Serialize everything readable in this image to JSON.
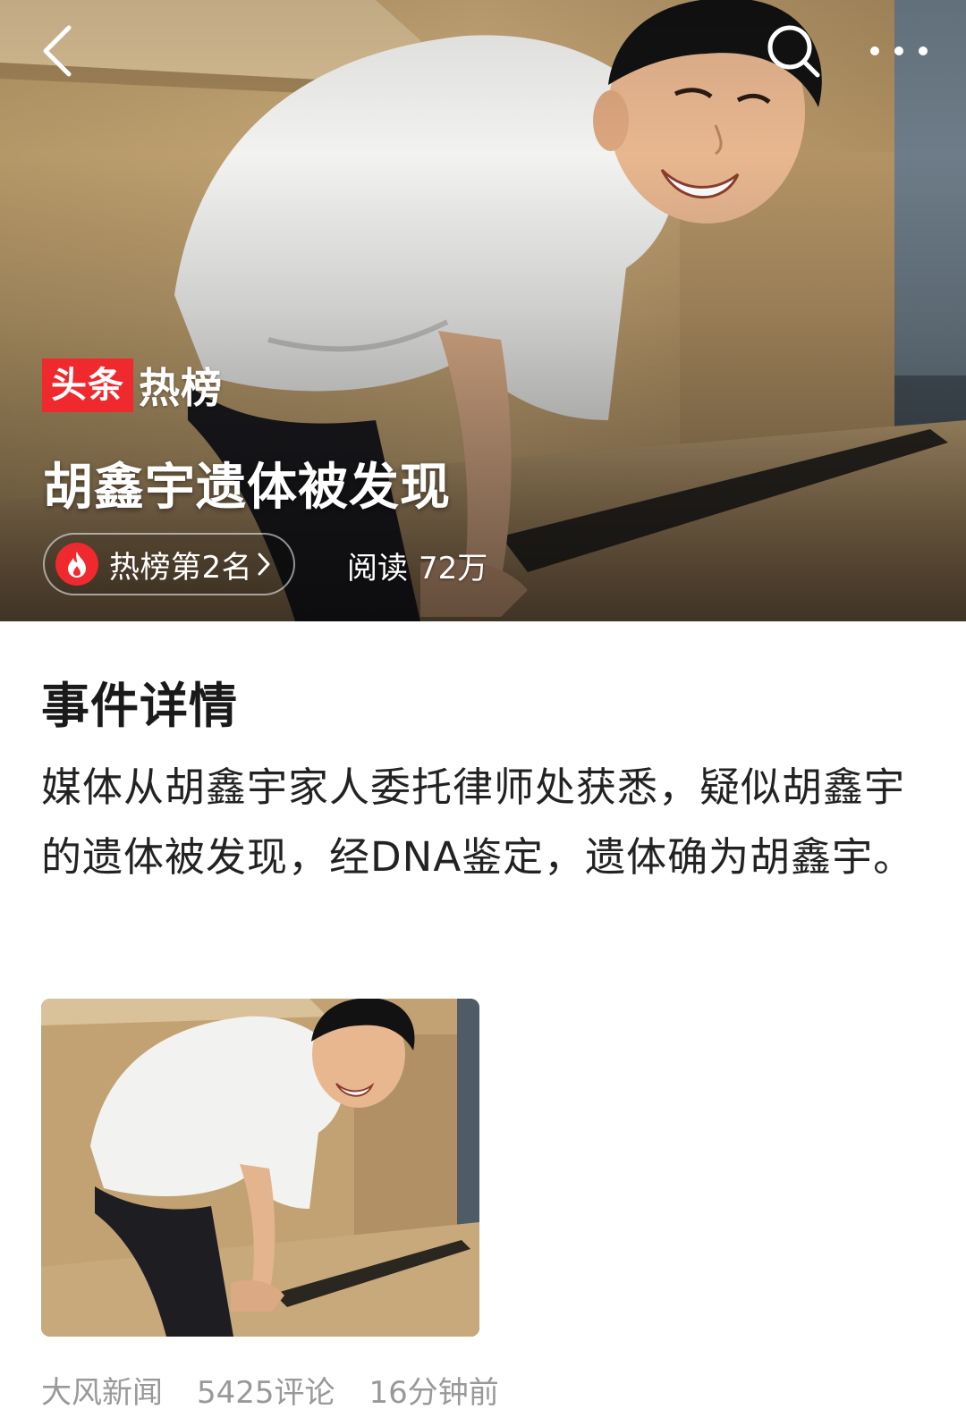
{
  "hero": {
    "brand_box": "头条",
    "brand_text": "热榜",
    "title": "胡鑫宇遗体被发现",
    "rank_label": "热榜第2名",
    "reads_label": "阅读",
    "reads_count": "72万"
  },
  "toolbar": {
    "back_icon": "chevron-left-icon",
    "search_icon": "search-icon",
    "more_icon": "more-dots-icon"
  },
  "section": {
    "heading": "事件详情",
    "summary": "媒体从胡鑫宇家人委托律师处获悉，疑似胡鑫宇的遗体被发现，经DNA鉴定，遗体确为胡鑫宇。"
  },
  "meta": {
    "source": "大风新闻",
    "comments": "5425评论",
    "time": "16分钟前"
  },
  "colors": {
    "accent_red": "#f0292f",
    "meta_gray": "#999999",
    "text_dark": "#1a1a1a"
  }
}
